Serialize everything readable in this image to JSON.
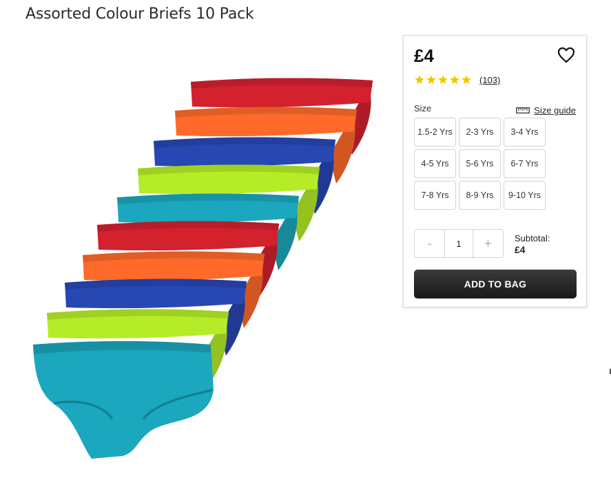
{
  "product": {
    "title": "Assorted Colour Briefs 10 Pack",
    "image_icon": "briefs-product-image",
    "colors": [
      "#d3212e",
      "#ff6a2a",
      "#2747b3",
      "#b5ec27",
      "#1ba7bd",
      "#d3212e",
      "#ff6a2a",
      "#2747b3",
      "#b5ec27",
      "#1ba7bd"
    ]
  },
  "buy_box": {
    "price": "£4",
    "wishlist_icon": "heart-outline-icon",
    "rating": {
      "stars": 5,
      "count": "(103)",
      "star_color": "#f5c400"
    },
    "size": {
      "label": "Size",
      "guide_label": "Size guide",
      "guide_icon": "ruler-icon",
      "options": [
        "1.5-2 Yrs",
        "2-3 Yrs",
        "3-4 Yrs",
        "4-5 Yrs",
        "5-6 Yrs",
        "6-7 Yrs",
        "7-8 Yrs",
        "8-9 Yrs",
        "9-10 Yrs"
      ]
    },
    "quantity": {
      "minus": "-",
      "value": "1",
      "plus": "+"
    },
    "subtotal": {
      "label": "Subtotal:",
      "value": "£4"
    },
    "add_to_bag": "ADD TO BAG"
  }
}
